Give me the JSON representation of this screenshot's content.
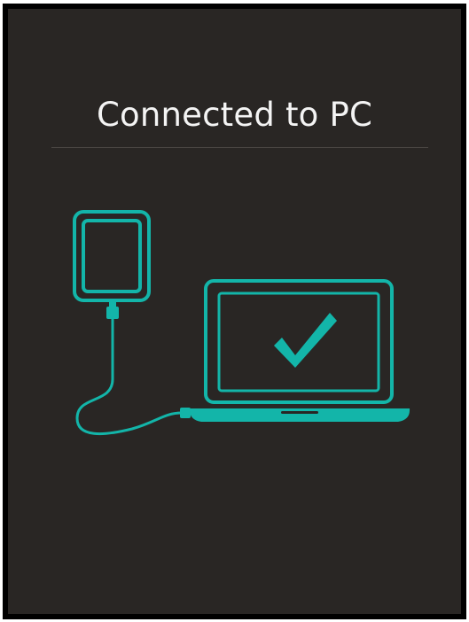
{
  "screen": {
    "title": "Connected to PC"
  },
  "illustration": {
    "accent_color": "#13b5a9",
    "background_color": "#292624",
    "icons": [
      "ereader-device-icon",
      "usb-cable-icon",
      "laptop-icon",
      "checkmark-icon"
    ]
  }
}
